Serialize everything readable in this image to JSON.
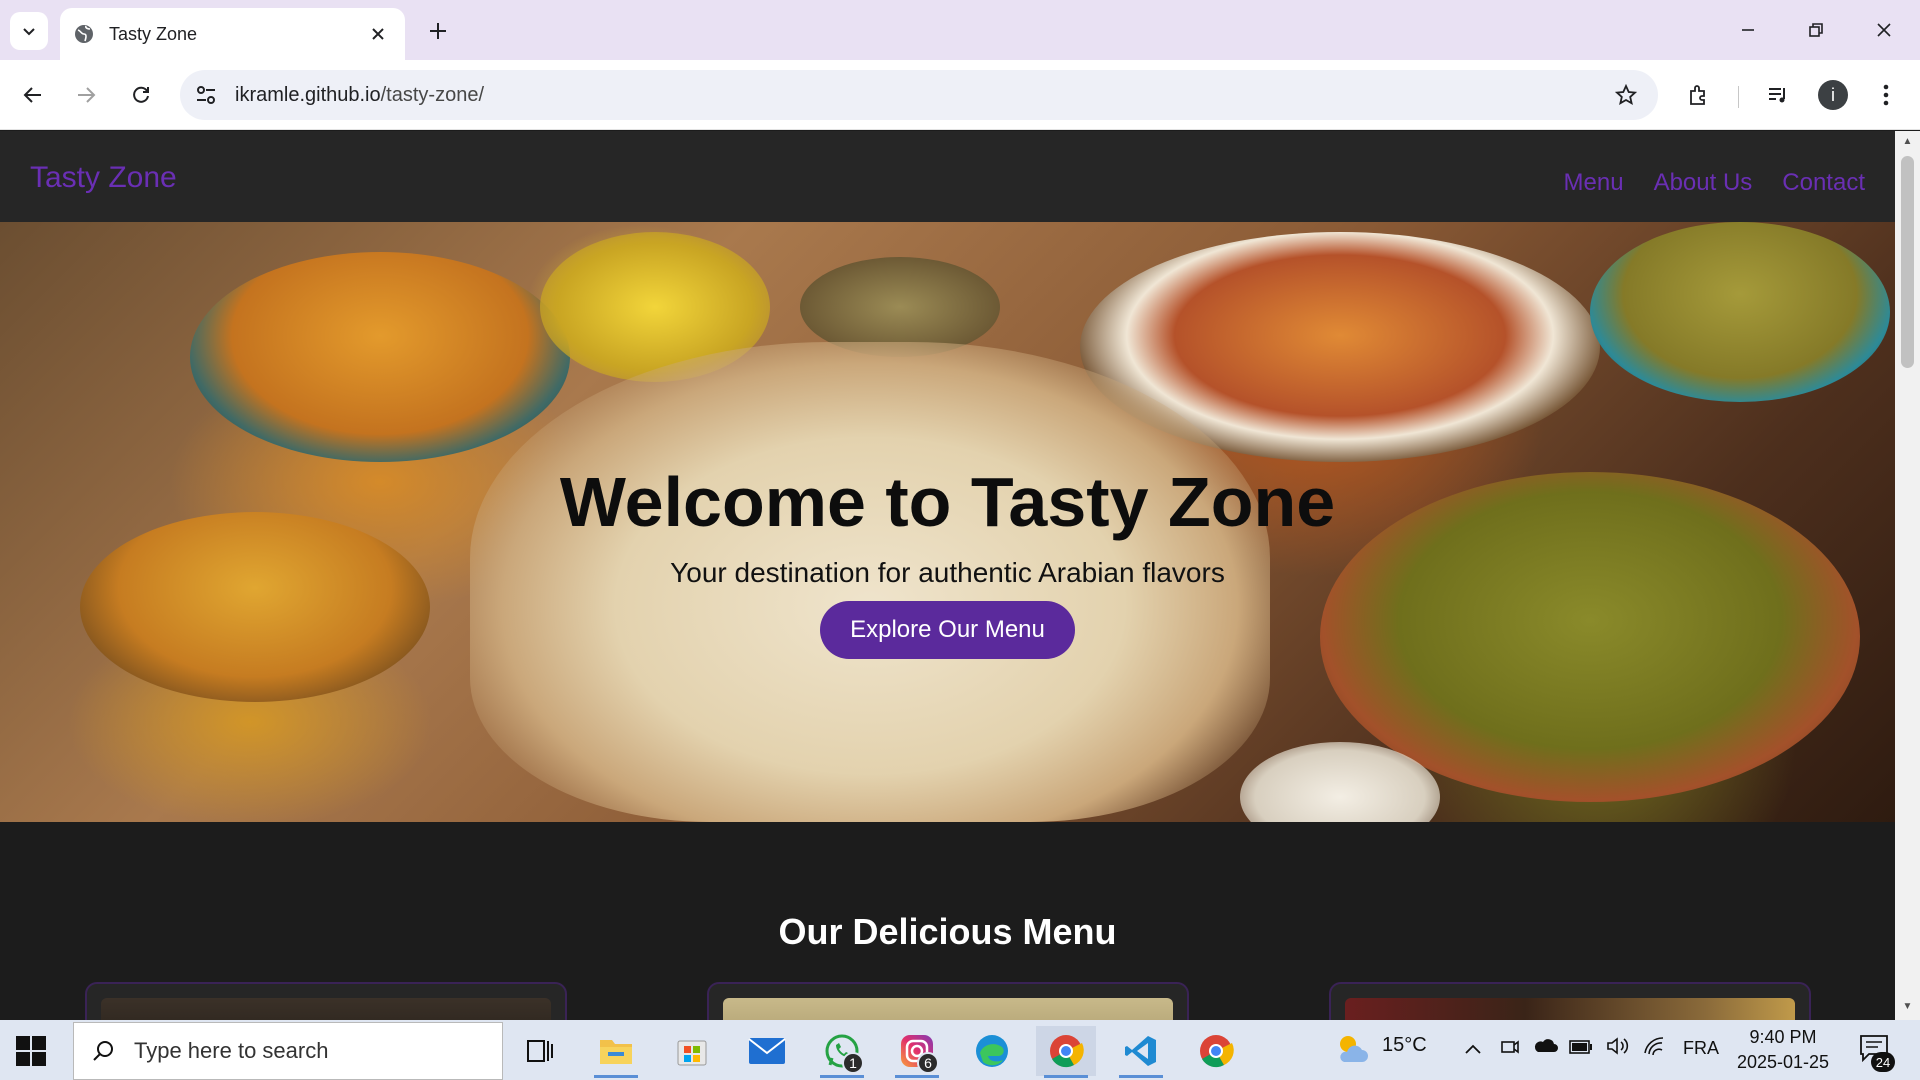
{
  "browser": {
    "tab_title": "Tasty Zone",
    "url_host": "ikramle.github.io",
    "url_path": "/tasty-zone/",
    "profile_initial": "i"
  },
  "site": {
    "logo": "Tasty Zone",
    "nav": [
      "Menu",
      "About Us",
      "Contact"
    ],
    "hero_title": "Welcome to Tasty Zone",
    "hero_subtitle": "Your destination for authentic Arabian flavors",
    "hero_button": "Explore Our Menu",
    "menu_heading": "Our Delicious Menu"
  },
  "taskbar": {
    "search_placeholder": "Type here to search",
    "whatsapp_badge": "1",
    "instagram_badge": "6",
    "weather": "15°C",
    "language": "FRA",
    "time": "9:40 PM",
    "date": "2025-01-25",
    "notifications": "24"
  },
  "colors": {
    "accent_purple": "#6a2fb4",
    "button_purple": "#5b2a9c",
    "page_bg": "#1c1c1c"
  }
}
